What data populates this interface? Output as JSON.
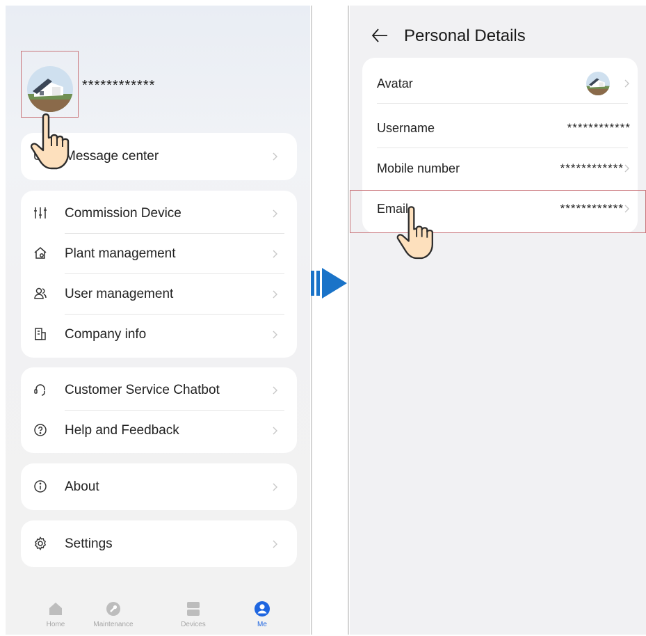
{
  "left_screen": {
    "username": "************",
    "message_center_label": "Message center",
    "menu_groups": [
      [
        {
          "label": "Message center",
          "icon": "message-icon"
        }
      ],
      [
        {
          "label": "Commission Device",
          "icon": "sliders-icon"
        },
        {
          "label": "Plant management",
          "icon": "plant-house-icon"
        },
        {
          "label": "User management",
          "icon": "users-icon"
        },
        {
          "label": "Company info",
          "icon": "building-icon"
        }
      ],
      [
        {
          "label": "Customer Service Chatbot",
          "icon": "headset-icon"
        },
        {
          "label": "Help and Feedback",
          "icon": "help-icon"
        }
      ],
      [
        {
          "label": "About",
          "icon": "info-icon"
        }
      ],
      [
        {
          "label": "Settings",
          "icon": "gear-icon"
        }
      ]
    ],
    "bottom_nav": [
      {
        "label": "Home",
        "icon": "home-icon",
        "active": false
      },
      {
        "label": "Maintenance",
        "icon": "wrench-icon",
        "active": false
      },
      {
        "label": "Devices",
        "icon": "devices-icon",
        "active": false
      },
      {
        "label": "Me",
        "icon": "person-icon",
        "active": true
      }
    ]
  },
  "right_screen": {
    "title": "Personal Details",
    "rows": [
      {
        "label": "Avatar",
        "value": ""
      },
      {
        "label": "Username",
        "value": "************"
      },
      {
        "label": "Mobile number",
        "value": "************"
      },
      {
        "label": "Email",
        "value": "************"
      }
    ]
  },
  "colors": {
    "accent": "#1f66e0",
    "highlight_border": "#c9757a",
    "arrow": "#1a73c8",
    "card": "#ffffff",
    "background": "#f1f1f3"
  }
}
